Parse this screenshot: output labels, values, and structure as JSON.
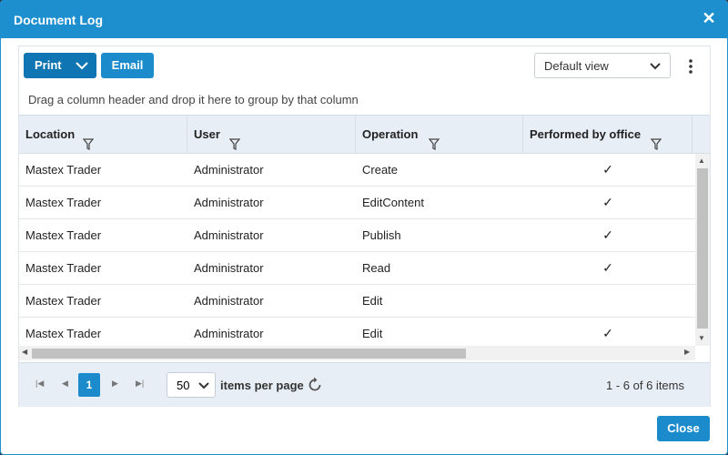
{
  "dialog": {
    "title": "Document Log",
    "close_icon": "close-icon"
  },
  "toolbar": {
    "print_label": "Print",
    "email_label": "Email",
    "view_select_value": "Default view",
    "more_icon": "vertical-dots-icon"
  },
  "grid": {
    "group_hint": "Drag a column header and drop it here to group by that column",
    "columns": [
      "Location",
      "User",
      "Operation",
      "Performed by office"
    ],
    "rows": [
      {
        "location": "Mastex Trader",
        "user": "Administrator",
        "operation": "Create",
        "performed_by_office": "✓"
      },
      {
        "location": "Mastex Trader",
        "user": "Administrator",
        "operation": "EditContent",
        "performed_by_office": "✓"
      },
      {
        "location": "Mastex Trader",
        "user": "Administrator",
        "operation": "Publish",
        "performed_by_office": "✓"
      },
      {
        "location": "Mastex Trader",
        "user": "Administrator",
        "operation": "Read",
        "performed_by_office": "✓"
      },
      {
        "location": "Mastex Trader",
        "user": "Administrator",
        "operation": "Edit",
        "performed_by_office": ""
      },
      {
        "location": "Mastex Trader",
        "user": "Administrator",
        "operation": "Edit",
        "performed_by_office": "✓"
      }
    ]
  },
  "pager": {
    "current_page": "1",
    "page_size": "50",
    "items_per_page_label": "items per page",
    "summary": "1 - 6 of 6 items"
  },
  "footer": {
    "close_label": "Close"
  },
  "colors": {
    "accent": "#1b8bcc",
    "header_bg": "#e8eef6"
  }
}
